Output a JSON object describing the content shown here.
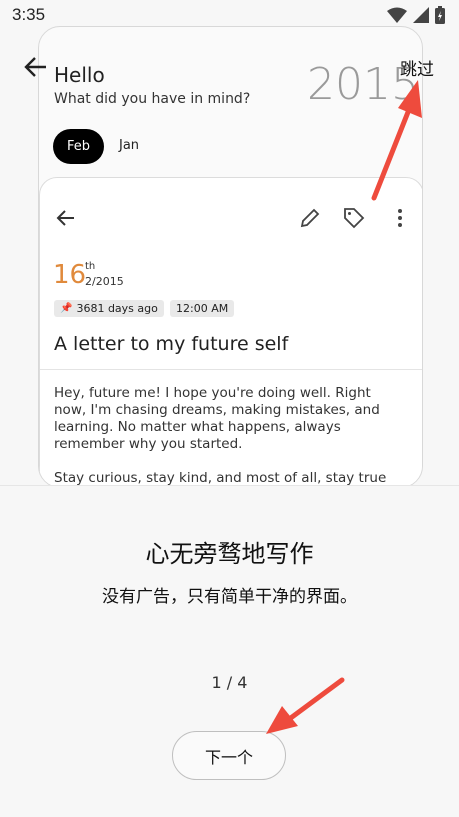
{
  "status_bar": {
    "time": "3:35"
  },
  "header": {
    "skip_label": "跳过"
  },
  "preview": {
    "greeting": "Hello",
    "prompt": "What did you have in mind?",
    "year": "2015",
    "months": {
      "selected": "Feb",
      "other": "Jan"
    },
    "entry": {
      "day": "16",
      "day_suffix": "th",
      "month_year": "2/2015",
      "days_ago": "3681 days ago",
      "time": "12:00 AM",
      "title": "A letter to my future self",
      "paragraph_1": "Hey, future me! I hope you're doing well. Right now, I'm chasing dreams, making mistakes, and learning. No matter what happens, always remember why you started.",
      "paragraph_2": "Stay curious, stay kind, and most of all, stay true"
    }
  },
  "onboarding": {
    "headline": "心无旁骛地写作",
    "subline": "没有广告，只有简单干净的界面。",
    "pager": "1 / 4",
    "next_label": "下一个"
  },
  "colors": {
    "accent_day": "#e08a3c",
    "annotation_arrow": "#ee4b3d"
  }
}
